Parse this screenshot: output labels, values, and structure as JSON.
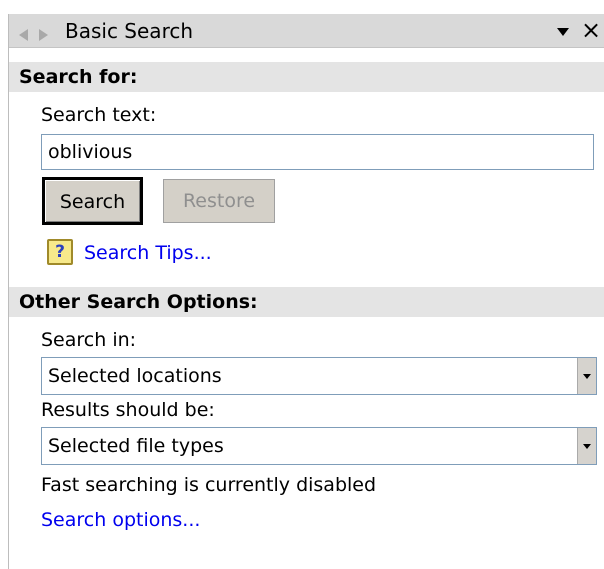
{
  "window": {
    "title": "Basic Search",
    "icons": {
      "back": "left-arrow-icon",
      "forward": "right-arrow-icon",
      "menu": "chevron-down-icon",
      "close": "close-icon"
    },
    "close_glyph": "×"
  },
  "search_for": {
    "header": "Search for:",
    "search_text_label": "Search text:",
    "search_text_value": "oblivious",
    "search_button": "Search",
    "restore_button": "Restore",
    "tips_icon_glyph": "?",
    "tips_link": "Search Tips..."
  },
  "other_options": {
    "header": "Other Search Options:",
    "search_in_label": "Search in:",
    "search_in_value": "Selected locations",
    "results_label": "Results should be:",
    "results_value": "Selected file types",
    "status_text": "Fast searching is currently disabled",
    "options_link": "Search options..."
  },
  "colors": {
    "link": "#0000ee",
    "header_bg": "#e4e4e4",
    "titlebar_bg": "#d9d9d9"
  }
}
